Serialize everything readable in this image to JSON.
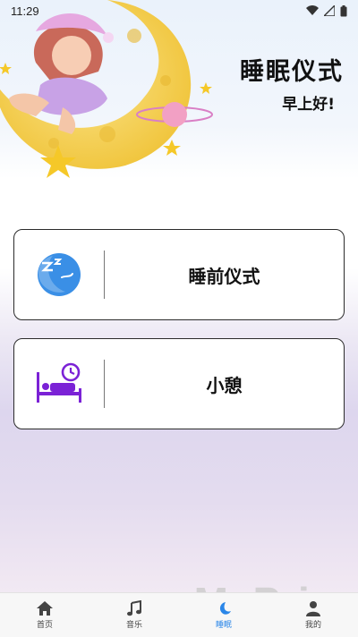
{
  "status": {
    "time": "11:29"
  },
  "header": {
    "title": "睡眠仪式",
    "greeting": "早上好!"
  },
  "cards": [
    {
      "label": "睡前仪式",
      "icon": "sleep-moon-icon"
    },
    {
      "label": "小憩",
      "icon": "bed-clock-icon"
    }
  ],
  "tabbar": {
    "items": [
      {
        "label": "首页",
        "icon": "home-icon"
      },
      {
        "label": "音乐",
        "icon": "music-icon"
      },
      {
        "label": "睡眠",
        "icon": "moon-icon",
        "active": true
      },
      {
        "label": "我的",
        "icon": "person-icon"
      }
    ]
  },
  "watermark": {
    "brand": "MyPrice",
    "domain": "www.myprice.com.cn"
  },
  "colors": {
    "accent": "#2a86e8",
    "nap_purple": "#7b22d6",
    "moon_yellow": "#f3d24b"
  }
}
